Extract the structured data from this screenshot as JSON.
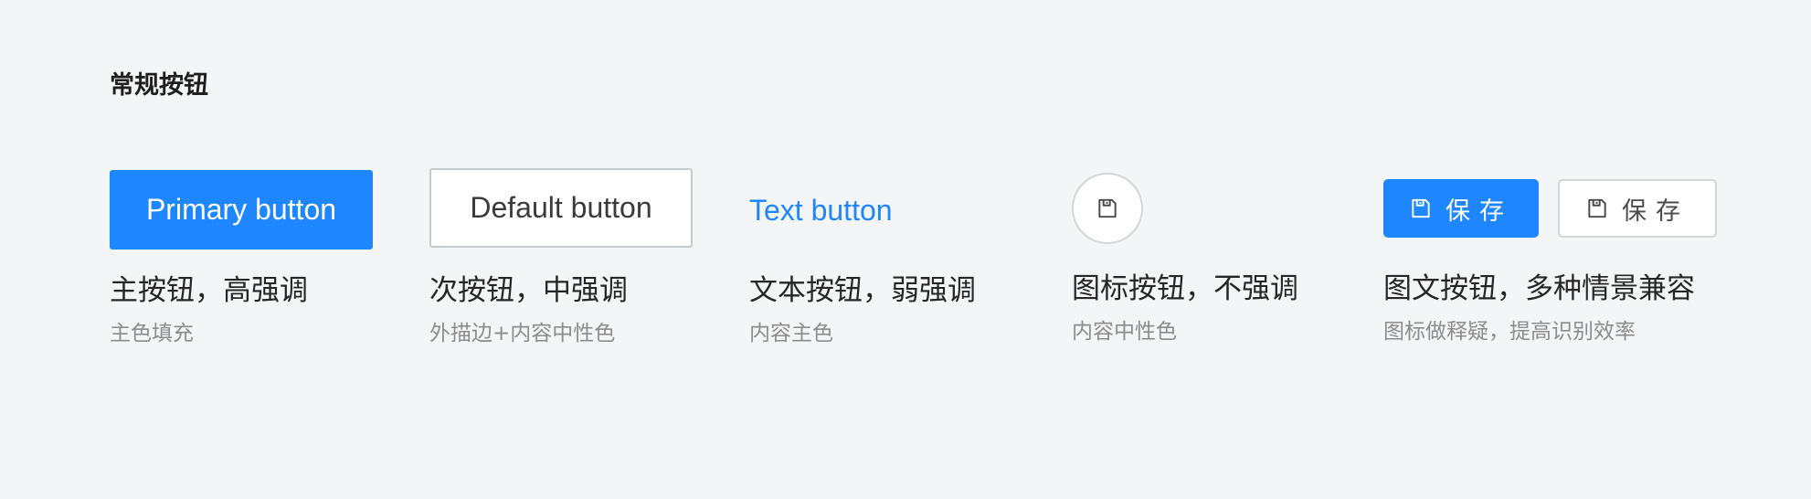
{
  "section": {
    "title": "常规按钮"
  },
  "colors": {
    "background": "#f4f5f7",
    "primary": "#1e86ff",
    "border": "#c6c9ce",
    "text": "#262626",
    "subtext": "#8c8c8c"
  },
  "buttons": {
    "primary": {
      "label": "Primary button",
      "caption": "主按钮，高强调",
      "description": "主色填充"
    },
    "default": {
      "label": "Default button",
      "caption": "次按钮，中强调",
      "description": "外描边+内容中性色"
    },
    "text": {
      "label": "Text button",
      "caption": "文本按钮，弱强调",
      "description": "内容主色"
    },
    "icon": {
      "icon": "save-icon",
      "caption": "图标按钮，不强调",
      "description": "内容中性色"
    },
    "icon_text": {
      "primary_label": "保存",
      "default_label": "保存",
      "icon": "save-icon",
      "caption": "图文按钮，多种情景兼容",
      "description": "图标做释疑，提高识别效率"
    }
  }
}
